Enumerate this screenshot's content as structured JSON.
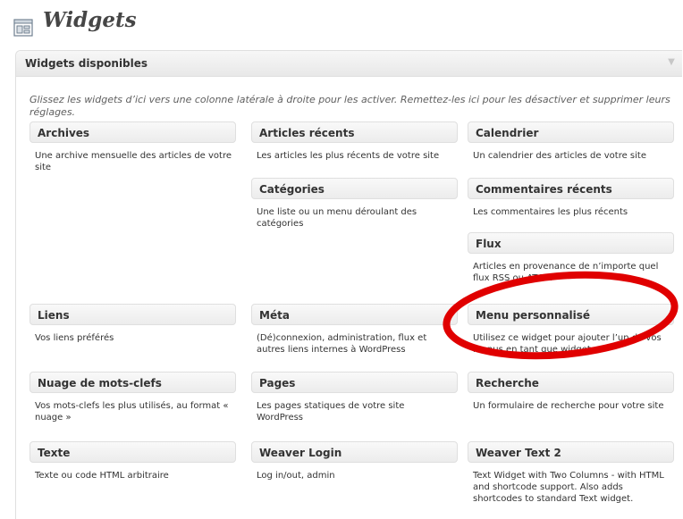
{
  "page": {
    "title": "Widgets",
    "icon": "widgets-icon"
  },
  "panel": {
    "title": "Widgets disponibles",
    "collapse_icon": "collapse-arrow-icon",
    "instructions": "Glissez les widgets d’ici vers une colonne latérale à droite pour les activer. Remettez-les ici pour les désactiver et supprimer leurs réglages."
  },
  "widgets": [
    {
      "title": "Archives",
      "description": "Une archive mensuelle des articles de votre site"
    },
    {
      "title": "Articles récents",
      "description": "Les articles les plus récents de votre site"
    },
    {
      "title": "Calendrier",
      "description": "Un calendrier des articles de votre site"
    },
    {
      "title": "Catégories",
      "description": "Une liste ou un menu déroulant des catégories"
    },
    {
      "title": "Commentaires récents",
      "description": "Les commentaires les plus récents"
    },
    {
      "title": "Flux",
      "description": "Articles en provenance de n’importe quel flux RSS ou ATOM"
    },
    {
      "title": "Liens",
      "description": "Vos liens préférés"
    },
    {
      "title": "Méta",
      "description": "(Dé)connexion, administration, flux et autres liens internes à WordPress"
    },
    {
      "title": "Menu personnalisé",
      "description": "Utilisez ce widget pour ajouter l’un de vos menus en tant que widget."
    },
    {
      "title": "Nuage de mots-clefs",
      "description": "Vos mots-clefs les plus utilisés, au format « nuage »"
    },
    {
      "title": "Pages",
      "description": "Les pages statiques de votre site WordPress"
    },
    {
      "title": "Recherche",
      "description": "Un formulaire de recherche pour votre site"
    },
    {
      "title": "Texte",
      "description": "Texte ou code HTML arbitraire"
    },
    {
      "title": "Weaver Login",
      "description": "Log in/out, admin"
    },
    {
      "title": "Weaver Text 2",
      "description": "Text Widget with Two Columns - with HTML and shortcode support. Also adds shortcodes to standard Text widget."
    }
  ],
  "colors": {
    "annotation": "#e00000",
    "panel_border": "#dfdfdf"
  }
}
